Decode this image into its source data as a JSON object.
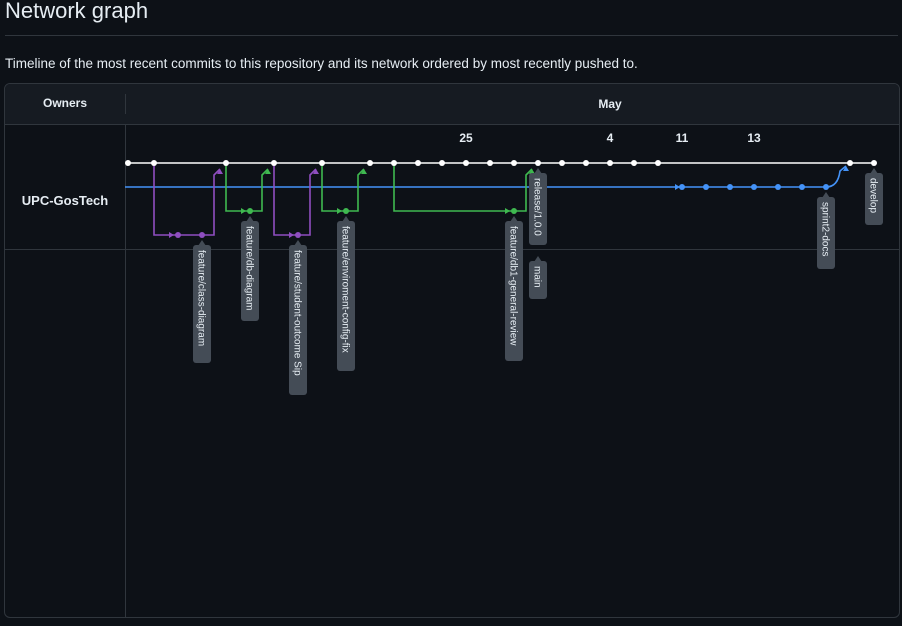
{
  "page": {
    "title": "Network graph",
    "description": "Timeline of the most recent commits to this repository and its network ordered by most recently pushed to."
  },
  "graph": {
    "owners_header": "Owners",
    "month": "May",
    "owner": "UPC-GosTech",
    "date_labels": [
      "25",
      "4",
      "11",
      "13"
    ],
    "branch_colors": {
      "develop": "#ffffff",
      "sprint2": "#4493f8",
      "features_purple": "#8f4ec0",
      "features_green": "#3fb950",
      "label_bg": "#444c56"
    },
    "branches": [
      {
        "name": "feature/class-diagram",
        "color": "#8f4ec0"
      },
      {
        "name": "feature/db-diagram",
        "color": "#3fb950"
      },
      {
        "name": "feature/student-outcome Sip",
        "color": "#8f4ec0"
      },
      {
        "name": "feature/enviroment-config-fix",
        "color": "#3fb950"
      },
      {
        "name": "feature/db1-general-review",
        "color": "#3fb950"
      },
      {
        "name": "release/1.0.0",
        "color": "#ffffff"
      },
      {
        "name": "main",
        "color": "#ffffff"
      },
      {
        "name": "sprint2-docs",
        "color": "#4493f8"
      },
      {
        "name": "develop",
        "color": "#ffffff"
      }
    ]
  }
}
